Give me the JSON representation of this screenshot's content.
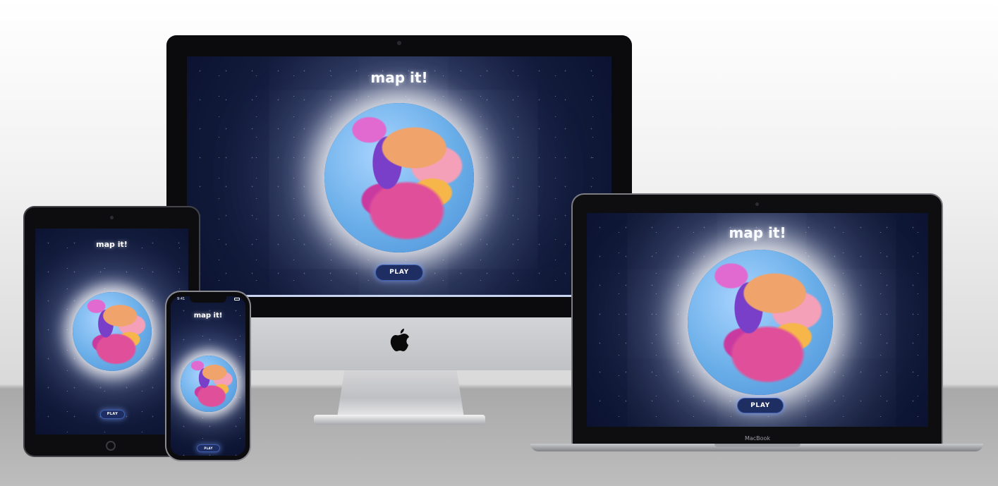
{
  "app": {
    "title": "map it!",
    "play_label": "PLAY"
  },
  "devices": {
    "imac": {
      "name": "iMac"
    },
    "macbook": {
      "name": "MacBook"
    },
    "ipad": {
      "name": "iPad"
    },
    "iphone": {
      "name": "iPhone",
      "status_time": "9:41"
    }
  },
  "icons": {
    "apple_logo": "apple-logo-icon"
  },
  "colors": {
    "screen_bg": "#121b3b",
    "ocean": "#6aaee8",
    "button_bg": "#1f2e62",
    "bezel": "#0b0b0d"
  }
}
